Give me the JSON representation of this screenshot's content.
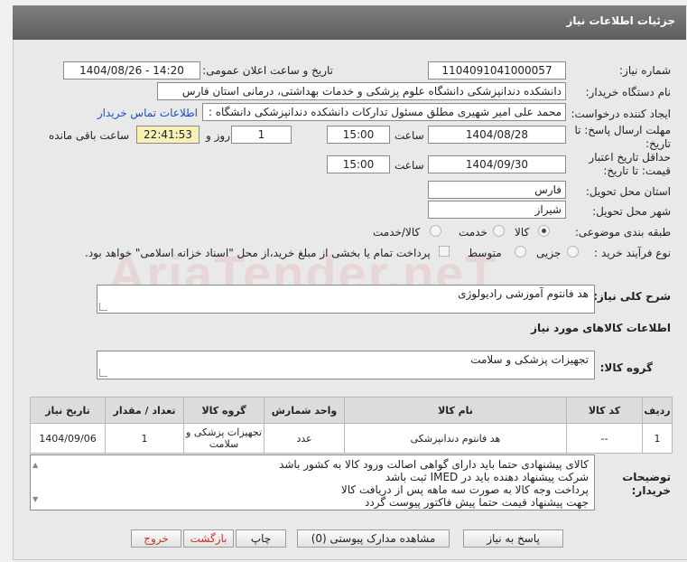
{
  "header": {
    "title": "جزئیات اطلاعات نیاز"
  },
  "watermark": "AriaTender.neT",
  "fields": {
    "need_number_label": "شماره نیاز:",
    "need_number": "1104091041000057",
    "announce_label": "تاریخ و ساعت اعلان عمومی:",
    "announce_value": "1404/08/26 - 14:20",
    "buyer_org_label": "نام دستگاه خریدار:",
    "buyer_org": "دانشکده دندانپزشکی دانشگاه علوم پزشکی و خدمات بهداشتی، درمانی استان فارس",
    "creator_label": "ایجاد کننده درخواست:",
    "creator": "محمد علی امیر شهیری مطلق مسئول تدارکات دانشکده دندانپزشکی دانشگاه :",
    "contact_link": "اطلاعات تماس خریدار",
    "deadline_label_1": "مهلت ارسال پاسخ: تا",
    "deadline_label_2": "تاریخ:",
    "deadline_date": "1404/08/28",
    "time_word": "ساعت",
    "deadline_time": "15:00",
    "days_value": "1",
    "days_word": "روز و",
    "remaining_time": "22:41:53",
    "remaining_word": "ساعت باقی مانده",
    "validity_label_1": "حداقل تاریخ اعتبار",
    "validity_label_2": "قیمت: تا تاریخ:",
    "validity_date": "1404/09/30",
    "validity_time": "15:00",
    "province_label": "استان محل تحویل:",
    "province": "فارس",
    "city_label": "شهر محل تحویل:",
    "city": "شیراز",
    "category_label": "طبقه بندی موضوعی:",
    "category_options": [
      "کالا",
      "خدمت",
      "کالا/خدمت"
    ],
    "process_label": "نوع فرآیند خرید :",
    "process_options": [
      "جزیی",
      "متوسط"
    ],
    "treasury_note": "پرداخت تمام یا بخشی از مبلغ خرید،از محل \"اسناد خزانه اسلامی\" خواهد بود."
  },
  "summary": {
    "label": "شرح کلی نیاز:",
    "value": "هد فانتوم آموزشی رادیولوژی"
  },
  "goods_info_title": "اطلاعات کالاهای مورد نیاز",
  "goods_group": {
    "label": "گروه کالا:",
    "value": "تجهیزات پزشکی و سلامت"
  },
  "table": {
    "headers": [
      "ردیف",
      "کد کالا",
      "نام کالا",
      "واحد شمارش",
      "گروه کالا",
      "تعداد / مقدار",
      "تاریخ نیاز"
    ],
    "rows": [
      [
        "1",
        "--",
        "هد فانتوم دندانپزشکی",
        "عدد",
        "تجهیزات پزشکی و سلامت",
        "1",
        "1404/09/06"
      ]
    ]
  },
  "buyer_notes": {
    "label_1": "توضیحات",
    "label_2": "خریدار:",
    "lines": [
      "کالای پیشنهادی حتما باید دارای گواهی اصالت ورود کالا به کشور باشد",
      "شرکت پیشنهاد دهنده باید در IMED ثبت باشد",
      "پرداخت وجه کالا به صورت سه ماهه پس از دریافت کالا",
      "جهت پیشنهاد قیمت حتما پیش فاکتور پیوست گردد"
    ]
  },
  "buttons": {
    "reply": "پاسخ به نیاز",
    "attachments": "مشاهده مدارک پیوستی (0)",
    "print": "چاپ",
    "back": "بازگشت",
    "exit": "خروج"
  },
  "colors": {
    "header": "#6e6e6e",
    "link": "#1f4fc4",
    "remaining_bg": "#f7f1b8",
    "exit_text": "#c0392b"
  }
}
